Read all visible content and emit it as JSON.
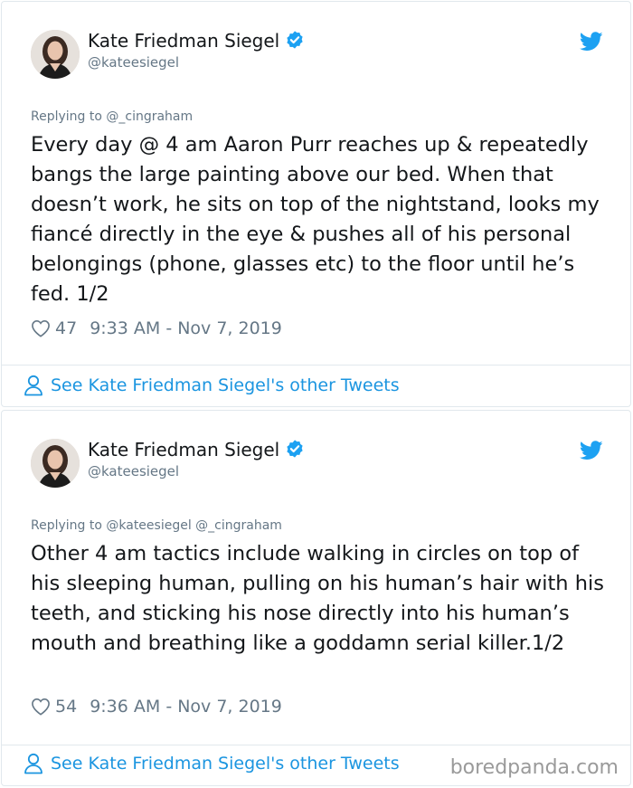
{
  "tweets": [
    {
      "author_name": "Kate Friedman Siegel",
      "handle": "@kateesiegel",
      "replying_to": "Replying to @_cingraham",
      "text": "Every day @ 4 am Aaron Purr reaches up & repeatedly bangs the large painting above our bed. When that doesn’t work, he sits on top of the nightstand, looks my fiancé directly in the eye & pushes all of his personal belongings (phone, glasses etc) to the floor until he’s fed. 1/2",
      "likes": "47",
      "timestamp": "9:33 AM - Nov 7, 2019",
      "see_more": "See Kate Friedman Siegel's other Tweets"
    },
    {
      "author_name": "Kate Friedman Siegel",
      "handle": "@kateesiegel",
      "replying_to": "Replying to @kateesiegel @_cingraham",
      "text": "Other 4 am tactics include walking in circles on top of his sleeping human, pulling on his human’s hair with his teeth, and sticking his nose directly into his human’s mouth and breathing like a goddamn serial killer.1/2",
      "likes": "54",
      "timestamp": "9:36 AM - Nov 7, 2019",
      "see_more": "See Kate Friedman Siegel's other Tweets"
    }
  ],
  "watermark": "boredpanda.com",
  "colors": {
    "twitter_blue": "#1da1f2",
    "link_blue": "#1b95e0",
    "secondary_text": "#657786",
    "border": "#e1e8ed"
  },
  "icons": [
    "avatar",
    "verified-badge-icon",
    "twitter-bird-icon",
    "heart-icon",
    "person-icon"
  ]
}
